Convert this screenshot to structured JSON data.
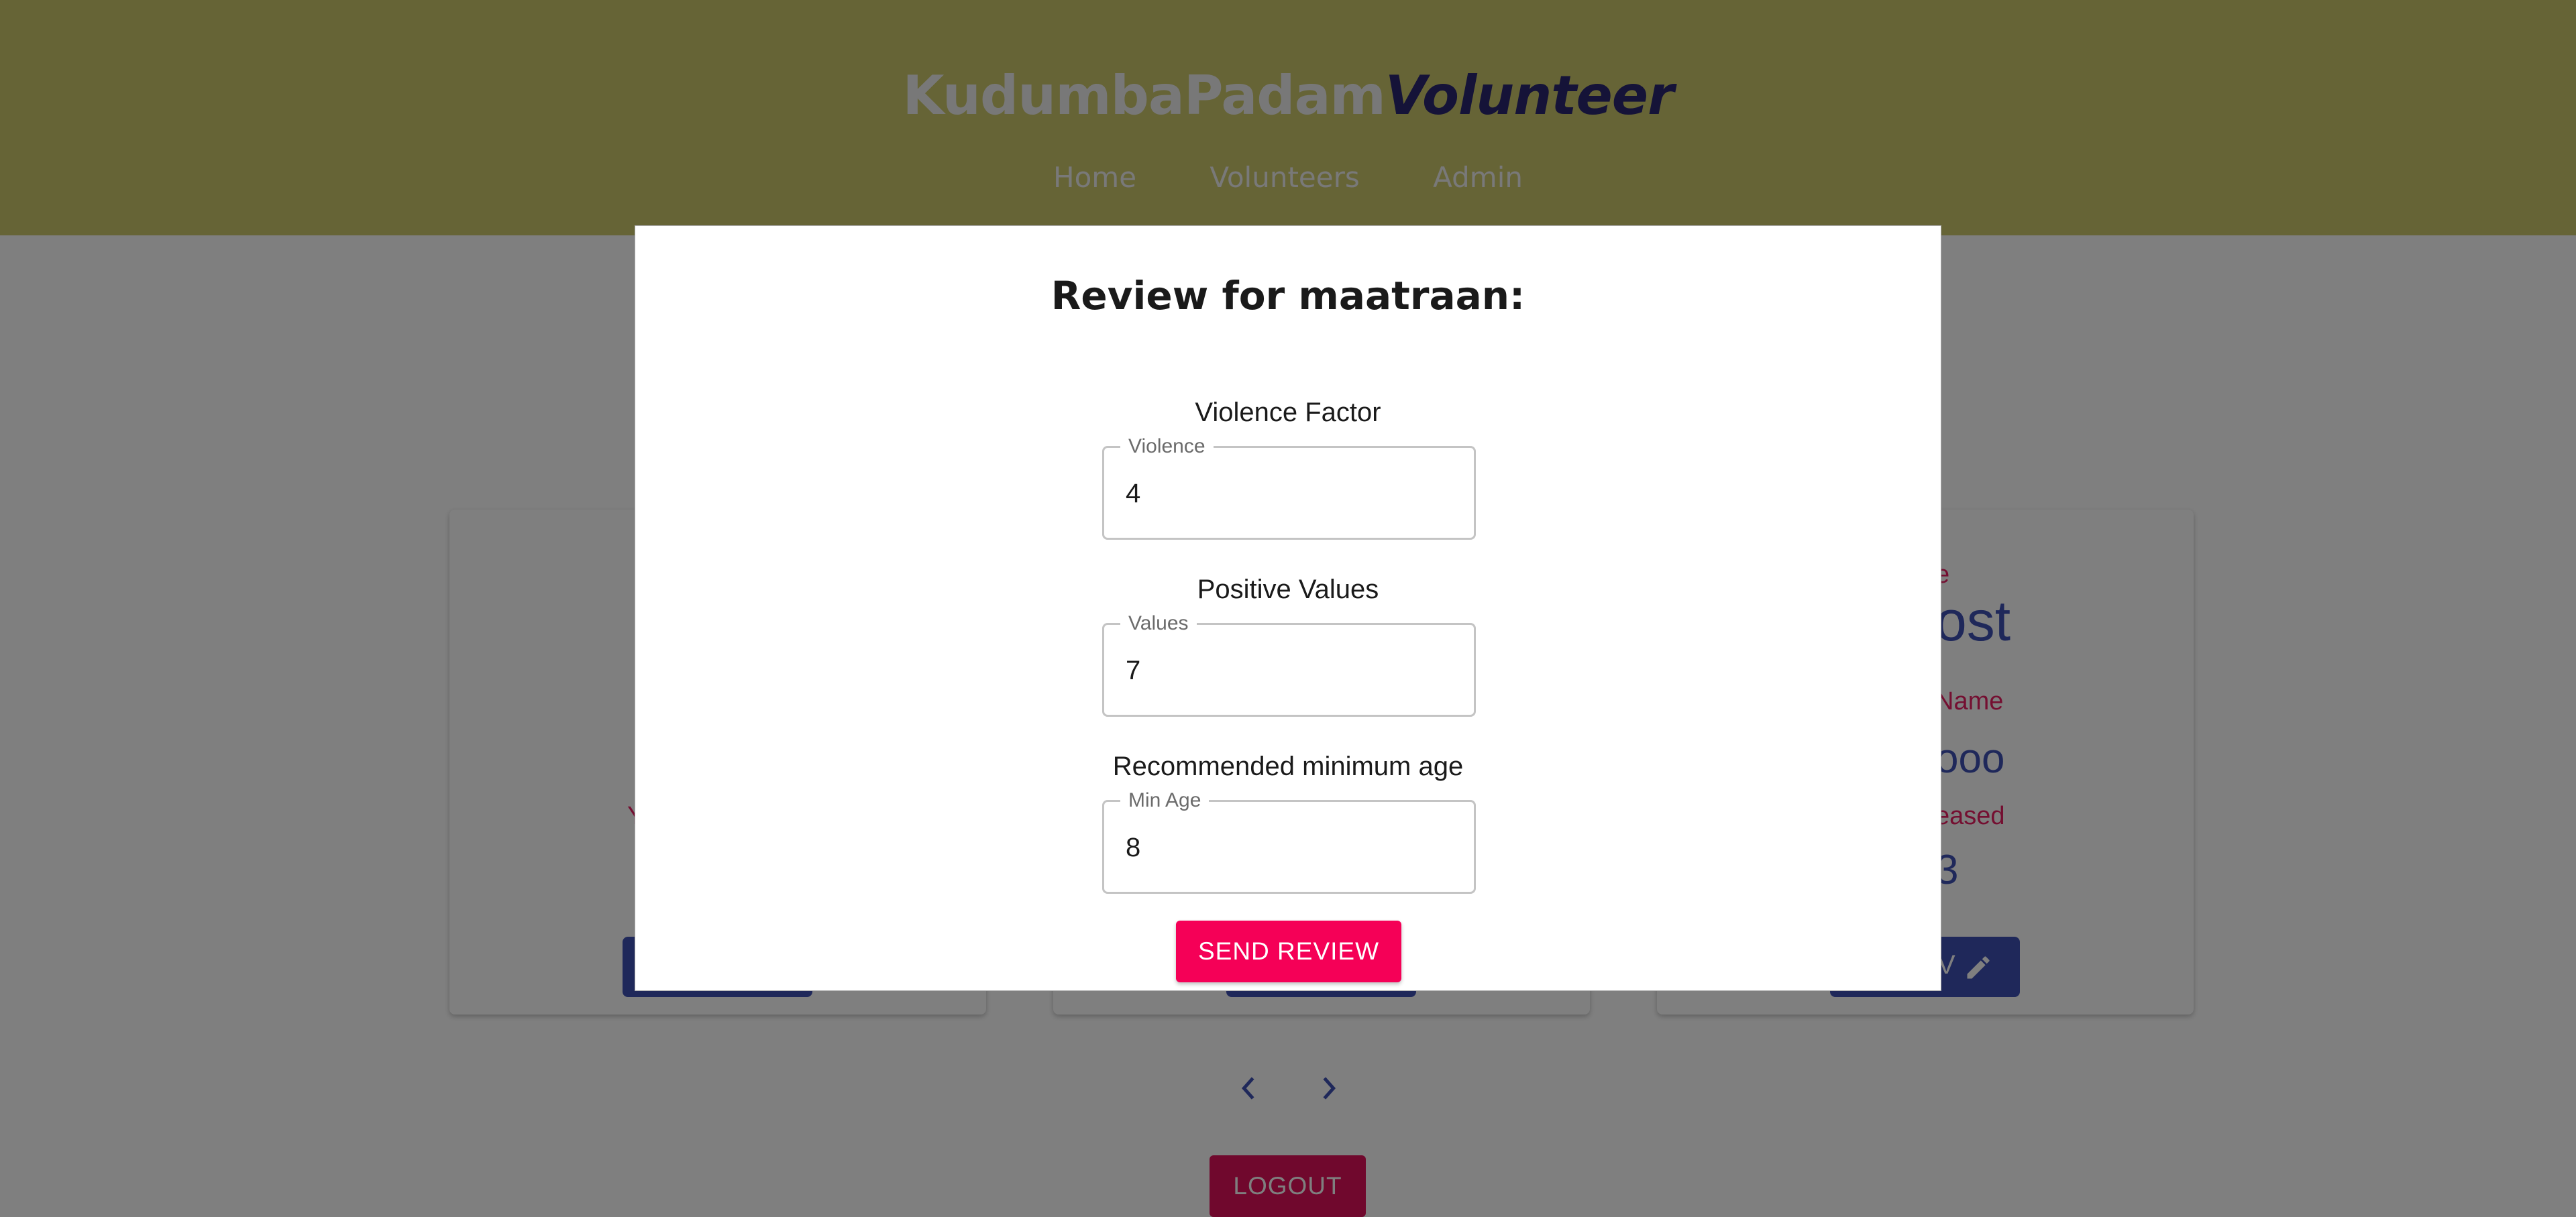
{
  "header": {
    "brand_part1": "KudumbaPadam",
    "brand_part2": "Volunteer",
    "nav": [
      "Home",
      "Volunteers",
      "Admin"
    ]
  },
  "background": {
    "card_right": {
      "label_1": "e",
      "value_1": "ost",
      "label_2": "Name",
      "value_2": "ooo",
      "label_3": "eased",
      "value_3": "3",
      "button_label": "V"
    },
    "card_left": {
      "label_fragment": "Y"
    },
    "logout_label": "LOGOUT"
  },
  "modal": {
    "title": "Review for maatraan:",
    "fields": [
      {
        "heading": "Violence Factor",
        "label": "Violence",
        "value": "4"
      },
      {
        "heading": "Positive Values",
        "label": "Values",
        "value": "7"
      },
      {
        "heading": "Recommended minimum age",
        "label": "Min Age",
        "value": "8"
      }
    ],
    "submit_label": "SEND REVIEW"
  },
  "colors": {
    "header_bg": "#ccc86c",
    "primary": "#3f51b5",
    "secondary": "#f50057",
    "brand_accent": "#2a2670",
    "backdrop": "rgba(0,0,0,0.5)"
  },
  "icons": {
    "edit": "pencil-icon",
    "prev": "chevron-left-icon",
    "next": "chevron-right-icon"
  }
}
